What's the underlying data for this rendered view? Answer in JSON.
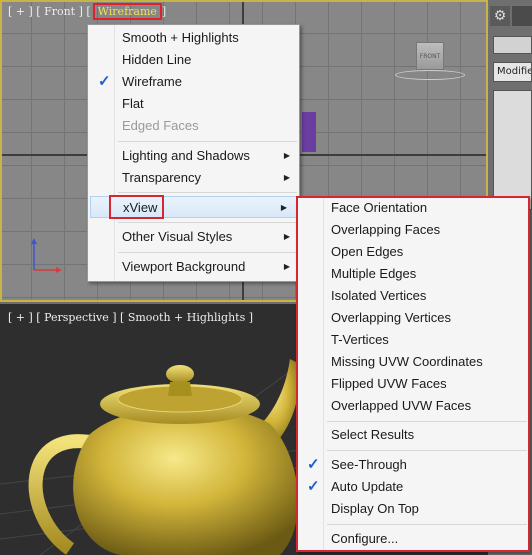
{
  "front_viewport": {
    "label_prefix": "[ + ] [ Front ] [",
    "label_mode": "Wireframe",
    "label_suffix": "]",
    "viewcube_label": "FRONT"
  },
  "perspective_viewport": {
    "label": "[ + ] [ Perspective ] [ Smooth + Highlights ]"
  },
  "command_panel": {
    "modifier_list": "Modifier List"
  },
  "menu": {
    "items": [
      {
        "label": "Smooth + Highlights"
      },
      {
        "label": "Hidden Line"
      },
      {
        "label": "Wireframe",
        "checked": true
      },
      {
        "label": "Flat"
      },
      {
        "label": "Edged Faces",
        "disabled": true
      },
      {
        "label": "Lighting and Shadows"
      },
      {
        "label": "Transparency"
      },
      {
        "label": "xView"
      },
      {
        "label": "Other Visual Styles"
      },
      {
        "label": "Viewport Background"
      }
    ]
  },
  "submenu": {
    "items": [
      {
        "label": "Face Orientation"
      },
      {
        "label": "Overlapping Faces"
      },
      {
        "label": "Open Edges"
      },
      {
        "label": "Multiple Edges"
      },
      {
        "label": "Isolated Vertices"
      },
      {
        "label": "Overlapping Vertices"
      },
      {
        "label": "T-Vertices"
      },
      {
        "label": "Missing UVW Coordinates"
      },
      {
        "label": "Flipped UVW Faces"
      },
      {
        "label": "Overlapped UVW Faces"
      },
      {
        "label": "Select Results"
      },
      {
        "label": "See-Through",
        "checked": true
      },
      {
        "label": "Auto Update",
        "checked": true
      },
      {
        "label": "Display On Top"
      },
      {
        "label": "Configure..."
      }
    ]
  },
  "colors": {
    "highlight_border": "#d6262f",
    "check": "#1f5fcf",
    "teapot": "#c9b13a"
  }
}
